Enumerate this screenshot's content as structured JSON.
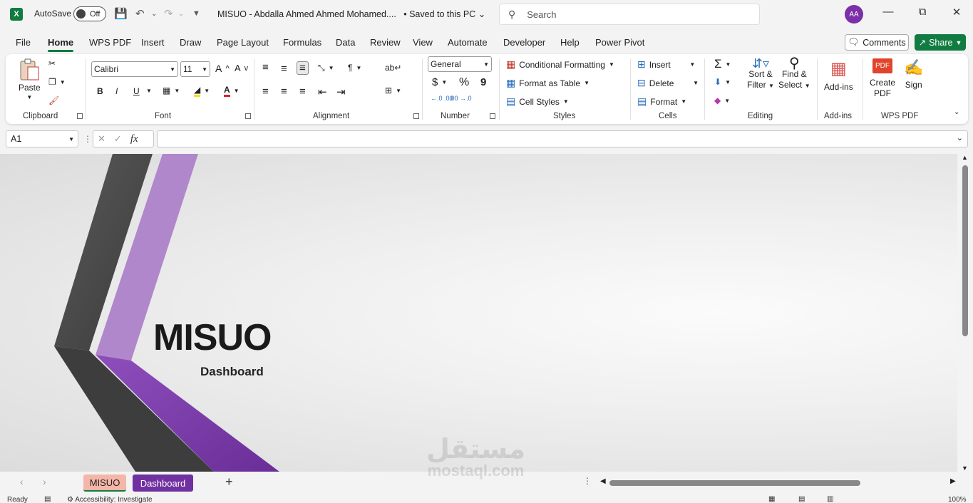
{
  "titlebar": {
    "autosave_label": "AutoSave",
    "autosave_state": "Off",
    "doc_title": "MISUO - Abdalla Ahmed Ahmed Mohamed....",
    "save_status": "• Saved to this PC",
    "search_placeholder": "Search",
    "avatar_initials": "AA"
  },
  "menu": {
    "tabs": [
      "File",
      "Home",
      "WPS PDF",
      "Insert",
      "Draw",
      "Page Layout",
      "Formulas",
      "Data",
      "Review",
      "View",
      "Automate",
      "Developer",
      "Help",
      "Power Pivot"
    ],
    "active_tab": "Home",
    "comments_label": "Comments",
    "share_label": "Share"
  },
  "ribbon": {
    "clipboard": {
      "paste_label": "Paste",
      "group_label": "Clipboard"
    },
    "font": {
      "font_name": "Calibri",
      "font_size": "11",
      "bold": "B",
      "italic": "I",
      "underline": "U",
      "group_label": "Font"
    },
    "alignment": {
      "group_label": "Alignment"
    },
    "number": {
      "format": "General",
      "currency": "$",
      "percent": "%",
      "comma": "9",
      "inc_decimal": "←.0 .00",
      "dec_decimal": ".00 →.0",
      "group_label": "Number"
    },
    "styles": {
      "conditional_formatting": "Conditional Formatting",
      "format_as_table": "Format as Table",
      "cell_styles": "Cell Styles",
      "group_label": "Styles"
    },
    "cells": {
      "insert": "Insert",
      "delete": "Delete",
      "format": "Format",
      "group_label": "Cells"
    },
    "editing": {
      "sort_filter_1": "Sort &",
      "sort_filter_2": "Filter",
      "find_select_1": "Find &",
      "find_select_2": "Select",
      "group_label": "Editing"
    },
    "addins": {
      "addins_label": "Add-ins",
      "group_label": "Add-ins"
    },
    "wps": {
      "create_pdf_1": "Create",
      "create_pdf_2": "PDF",
      "sign": "Sign",
      "group_label": "WPS PDF"
    }
  },
  "formula_bar": {
    "cell_ref": "A1",
    "fx": "fx",
    "content": ""
  },
  "sheet": {
    "title": "MISUO",
    "subtitle": "Dashboard"
  },
  "sheet_tabs": [
    {
      "label": "MISUO",
      "bg": "#f4b6a8",
      "color": "#222"
    },
    {
      "label": "Dashboard",
      "bg": "#7030a0",
      "color": "#ffffff"
    }
  ],
  "status": {
    "ready": "Ready",
    "accessibility": "Accessibility: Investigate",
    "zoom": "100%"
  },
  "watermark": {
    "arabic": "مستقل",
    "latin": "mostaql.com"
  },
  "colors": {
    "accent_green": "#107c41",
    "purple": "#7030a0",
    "light_purple": "#a779c6",
    "dark_gray": "#4a4a4a"
  }
}
